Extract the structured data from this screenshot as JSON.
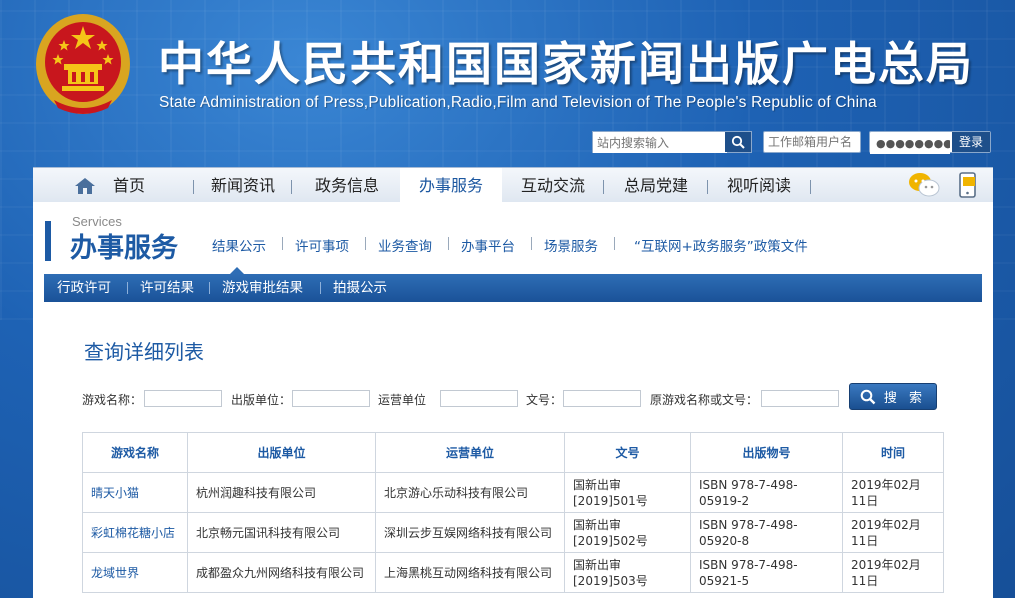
{
  "header": {
    "title_cn": "中华人民共和国国家新闻出版广电总局",
    "title_en": "State Administration of Press,Publication,Radio,Film and Television of The People's Republic of China",
    "search_placeholder": "站内搜索输入",
    "mail_placeholder": "工作邮箱用户名",
    "password_value": "●●●●●●●●●",
    "login_label": "登录"
  },
  "nav": {
    "items": [
      "首页",
      "新闻资讯",
      "政务信息",
      "办事服务",
      "互动交流",
      "总局党建",
      "视听阅读"
    ],
    "active": "办事服务"
  },
  "section": {
    "label_en": "Services",
    "label_cn": "办事服务",
    "sub_items": [
      "结果公示",
      "许可事项",
      "业务查询",
      "办事平台",
      "场景服务",
      "“互联网+政务服务”政策文件"
    ]
  },
  "subnav": {
    "items": [
      "行政许可",
      "许可结果",
      "游戏审批结果",
      "拍摄公示"
    ]
  },
  "page_title": "查询详细列表",
  "query": {
    "labels": [
      "游戏名称：",
      "出版单位：",
      "运营单位",
      "文号：",
      "原游戏名称或文号："
    ],
    "button": "搜 索"
  },
  "table": {
    "headers": [
      "游戏名称",
      "出版单位",
      "运营单位",
      "文号",
      "出版物号",
      "时间"
    ],
    "rows": [
      [
        "晴天小猫",
        "杭州润趣科技有限公司",
        "北京游心乐动科技有限公司",
        "国新出审[2019]501号",
        "ISBN 978-7-498-05919-2",
        "2019年02月11日"
      ],
      [
        "彩虹棉花糖小店",
        "北京畅元国讯科技有限公司",
        "深圳云步互娱网络科技有限公司",
        "国新出审[2019]502号",
        "ISBN 978-7-498-05920-8",
        "2019年02月11日"
      ],
      [
        "龙域世界",
        "成都盈众九州网络科技有限公司",
        "上海黑桃互动网络科技有限公司",
        "国新出审[2019]503号",
        "ISBN 978-7-498-05921-5",
        "2019年02月11日"
      ]
    ]
  },
  "colors": {
    "brand_blue": "#1d5aa4",
    "nav_active": "#ffffff"
  }
}
